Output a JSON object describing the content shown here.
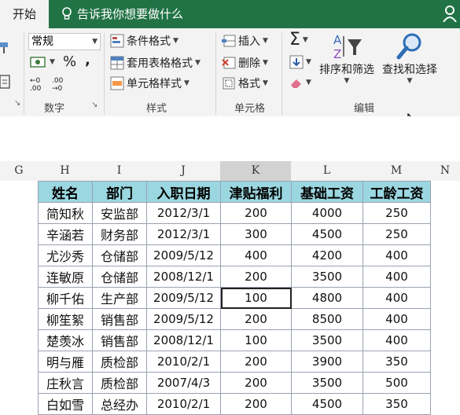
{
  "tabs": {
    "home": "开始",
    "tell_me": "告诉我你想要做什么"
  },
  "ribbon": {
    "number_format": "常规",
    "percent": "%",
    "comma": ",",
    "dec_inc": "←0 .00",
    "dec_dec": ".00 →0",
    "number_group": "数字",
    "conditional_format": "条件格式",
    "format_as_table": "套用表格格式",
    "cell_styles": "单元格样式",
    "styles_group": "样式",
    "insert": "插入",
    "delete": "删除",
    "format": "格式",
    "cells_group": "单元格",
    "sigma": "Σ",
    "sort_filter": "排序和筛选",
    "find_select": "查找和选择",
    "editing_group": "编辑"
  },
  "column_headers": [
    "G",
    "H",
    "I",
    "J",
    "K",
    "L",
    "M",
    "N"
  ],
  "table": {
    "headers": [
      "姓名",
      "部门",
      "入职日期",
      "津贴福利",
      "基础工资",
      "工龄工资"
    ],
    "rows": [
      [
        "简知秋",
        "安监部",
        "2012/3/1",
        "200",
        "4000",
        "250"
      ],
      [
        "辛涵若",
        "财务部",
        "2012/3/1",
        "300",
        "4500",
        "250"
      ],
      [
        "尤沙秀",
        "仓储部",
        "2009/5/12",
        "400",
        "4200",
        "400"
      ],
      [
        "连敏原",
        "仓储部",
        "2008/12/1",
        "200",
        "3500",
        "400"
      ],
      [
        "柳千佑",
        "生产部",
        "2009/5/12",
        "100",
        "4800",
        "400"
      ],
      [
        "柳笙絮",
        "销售部",
        "2009/5/12",
        "200",
        "8500",
        "400"
      ],
      [
        "楚羡冰",
        "销售部",
        "2008/12/1",
        "100",
        "3500",
        "400"
      ],
      [
        "明与雁",
        "质检部",
        "2010/2/1",
        "200",
        "3900",
        "350"
      ],
      [
        "庄秋言",
        "质检部",
        "2007/4/3",
        "200",
        "3500",
        "500"
      ],
      [
        "白如雪",
        "总经办",
        "2010/2/1",
        "200",
        "4500",
        "350"
      ]
    ]
  },
  "colors": {
    "brand": "#217346",
    "header_fill": "#9bd7e0"
  }
}
